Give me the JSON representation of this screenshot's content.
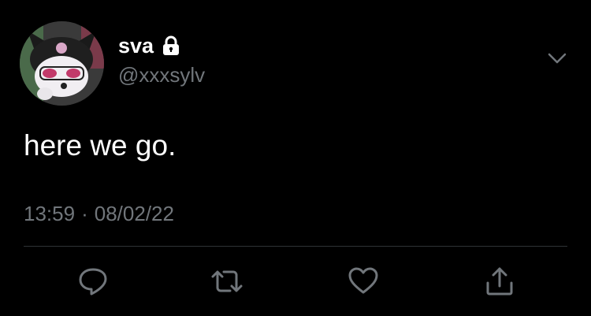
{
  "tweet": {
    "display_name": "sva",
    "handle": "@xxxsylv",
    "text": "here we go.",
    "time": "13:59",
    "separator": "·",
    "date": "08/02/22"
  },
  "icons": {
    "avatar": "avatar-kuromi",
    "protected": "lock-icon",
    "more": "chevron-down-icon",
    "reply": "reply-icon",
    "retweet": "retweet-icon",
    "like": "heart-icon",
    "share": "share-icon"
  },
  "colors": {
    "background": "#000000",
    "primary_text": "#ffffff",
    "secondary_text": "#71767b",
    "divider": "#2f3336"
  }
}
